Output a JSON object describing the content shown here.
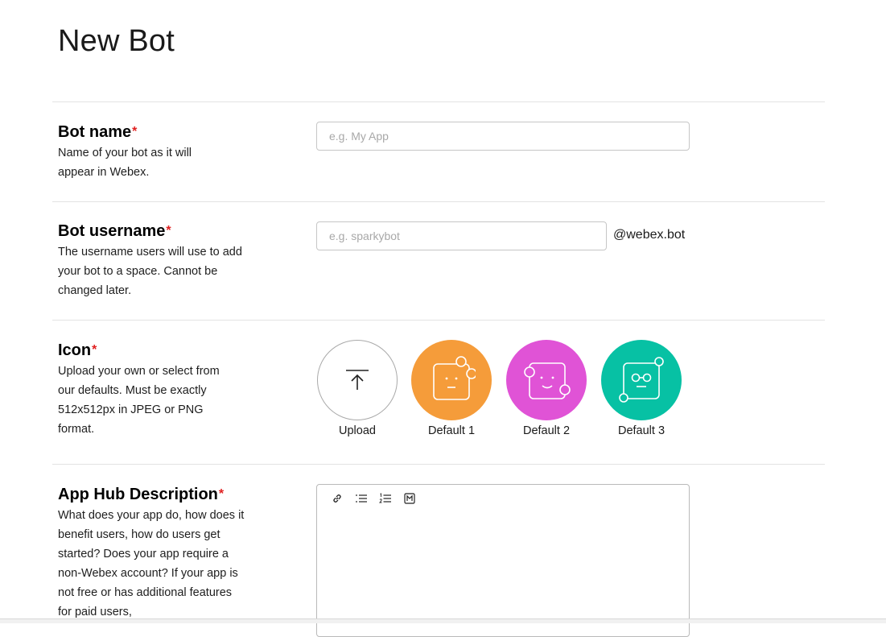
{
  "page": {
    "title": "New Bot"
  },
  "fields": {
    "bot_name": {
      "title": "Bot name",
      "required_mark": "*",
      "description": "Name of your bot as it will appear in Webex.",
      "placeholder": "e.g. My App",
      "value": ""
    },
    "bot_username": {
      "title": "Bot username",
      "required_mark": "*",
      "description": "The username users will use to add your bot to a space. Cannot be changed later.",
      "placeholder": "e.g. sparkybot",
      "value": "",
      "suffix": "@webex.bot"
    },
    "icon": {
      "title": "Icon",
      "required_mark": "*",
      "description": "Upload your own or select from our defaults. Must be exactly 512x512px in JPEG or PNG format.",
      "options": [
        {
          "label": "Upload",
          "icon": "upload-icon",
          "color": "#ffffff"
        },
        {
          "label": "Default 1",
          "icon": "bot-face-icon",
          "color": "#f59c3a"
        },
        {
          "label": "Default 2",
          "icon": "bot-smile-icon",
          "color": "#e053d6"
        },
        {
          "label": "Default 3",
          "icon": "bot-glasses-icon",
          "color": "#07c1a4"
        }
      ]
    },
    "app_hub_description": {
      "title": "App Hub Description",
      "required_mark": "*",
      "description": "What does your app do, how does it benefit users, how do users get started? Does your app require a non-Webex account? If your app is not free or has additional features for paid users,",
      "toolbar": [
        "link-icon",
        "bulleted-list-icon",
        "numbered-list-icon",
        "markdown-icon"
      ],
      "value": ""
    }
  },
  "colors": {
    "required": "#e02020",
    "divider": "#e3e3e3"
  }
}
